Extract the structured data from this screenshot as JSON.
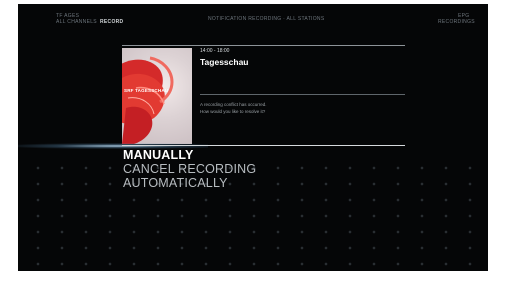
{
  "header": {
    "left_line1": "TF AGES",
    "left_line2": "ALL CHANNELS",
    "nav_active": "RECORD",
    "center_text": "NOTIFICATION RECORDING · ALL STATIONS",
    "right_line1": "EPG",
    "right_line2": "RECORDINGS"
  },
  "programme": {
    "channel_logo": "SRF TAGESSCHAU",
    "time": "14:00 - 18:00",
    "title": "Tagesschau"
  },
  "message": {
    "line1": "A recording conflict has occurred.",
    "line2": "How would you like to resolve it?"
  },
  "options": [
    {
      "label": "MANUALLY",
      "selected": true
    },
    {
      "label": "CANCEL RECORDING",
      "selected": false
    },
    {
      "label": "AUTOMATICALLY",
      "selected": false
    }
  ],
  "colors": {
    "background": "#050607",
    "selected_text": "#ffffff",
    "option_text": "#b7bcc0",
    "poster_accent": "#d42a2a"
  }
}
